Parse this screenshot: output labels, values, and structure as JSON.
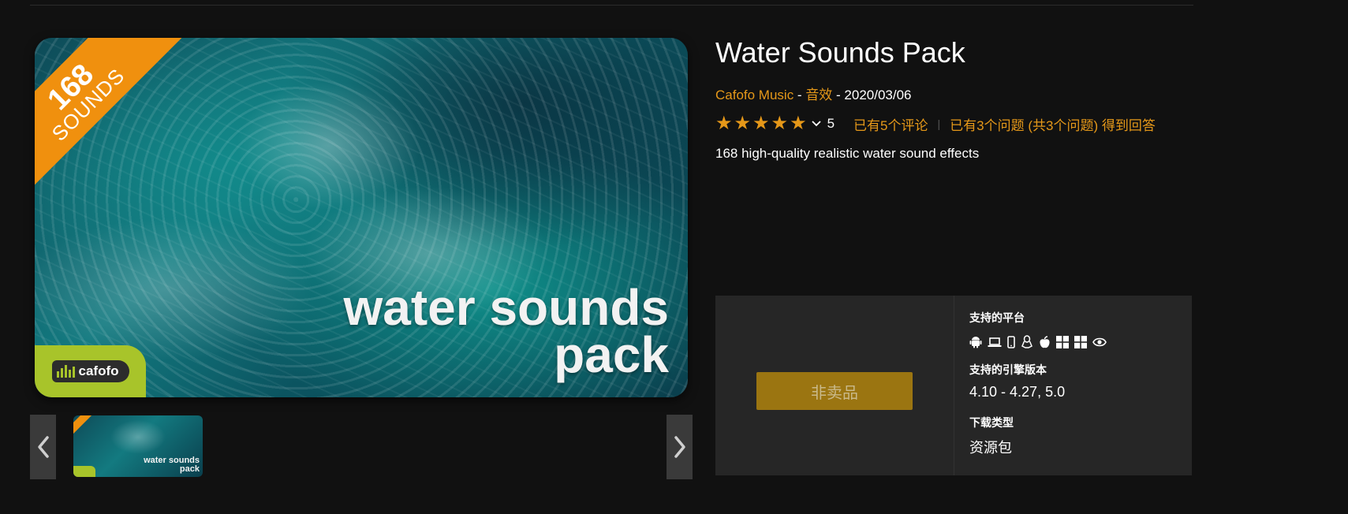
{
  "product": {
    "title": "Water Sounds Pack",
    "publisher": "Cafofo Music",
    "separator_1": " - ",
    "category": "音效",
    "separator_2": " - ",
    "date": "2020/03/06",
    "rating_value": "5",
    "stars": 5,
    "reviews_link": "已有5个评论",
    "questions_link": "已有3个问题 (共3个问题) 得到回答",
    "summary": "168 high-quality realistic water sound effects"
  },
  "hero": {
    "ribbon_number": "168",
    "ribbon_word": "SOUNDS",
    "title_line1": "water sounds",
    "title_line2": "pack",
    "logo_text": "cafofo"
  },
  "thumbnail": {
    "title_line1": "water sounds",
    "title_line2": "pack"
  },
  "panel": {
    "buy_button_label": "非卖品",
    "platforms_label": "支持的平台",
    "platform_icons": [
      "android-icon",
      "laptop-icon",
      "mobile-icon",
      "linux-icon",
      "apple-icon",
      "windows-icon",
      "windows-icon",
      "eye-icon"
    ],
    "engine_label": "支持的引擎版本",
    "engine_value": "4.10 - 4.27, 5.0",
    "download_type_label": "下载类型",
    "download_type_value": "资源包"
  },
  "colors": {
    "accent": "#e59819",
    "button": "#9b7511",
    "background": "#111111",
    "panel": "#262626"
  }
}
